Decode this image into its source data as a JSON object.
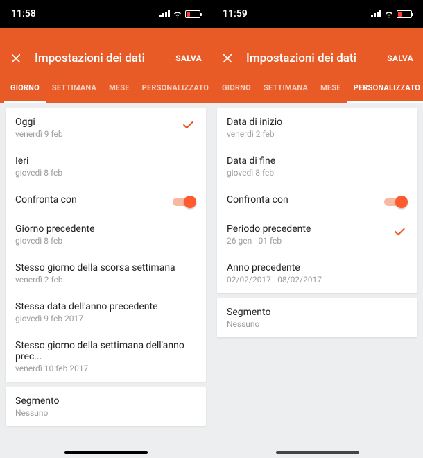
{
  "left": {
    "time": "11:58",
    "title": "Impostazioni dei dati",
    "save": "SALVA",
    "tabs": [
      {
        "label": "GIORNO",
        "active": true
      },
      {
        "label": "SETTIMANA",
        "active": false
      },
      {
        "label": "MESE",
        "active": false
      },
      {
        "label": "PERSONALIZZATO",
        "active": false
      }
    ],
    "card1": [
      {
        "title": "Oggi",
        "sub": "venerdì 9 feb",
        "checked": true
      },
      {
        "title": "Ieri",
        "sub": "giovedì 8 feb",
        "checked": false
      }
    ],
    "compare": {
      "title": "Confronta con",
      "on": true
    },
    "card1b": [
      {
        "title": "Giorno precedente",
        "sub": "giovedì 8 feb"
      },
      {
        "title": "Stesso giorno della scorsa settimana",
        "sub": "venerdì 2 feb"
      },
      {
        "title": "Stessa data dell'anno precedente",
        "sub": "giovedì 9 feb 2017"
      },
      {
        "title": "Stesso giorno della settimana dell'anno prec...",
        "sub": "venerdì 10 feb 2017"
      }
    ],
    "card2": {
      "title": "Segmento",
      "sub": "Nessuno"
    }
  },
  "right": {
    "time": "11:59",
    "title": "Impostazioni dei dati",
    "save": "SALVA",
    "tabs": [
      {
        "label": "GIORNO",
        "active": false
      },
      {
        "label": "SETTIMANA",
        "active": false
      },
      {
        "label": "MESE",
        "active": false
      },
      {
        "label": "PERSONALIZZATO",
        "active": true
      }
    ],
    "card1": [
      {
        "title": "Data di inizio",
        "sub": "venerdì 2 feb"
      },
      {
        "title": "Data di fine",
        "sub": "giovedì 8 feb"
      }
    ],
    "compare": {
      "title": "Confronta con",
      "on": true
    },
    "card1b": [
      {
        "title": "Periodo precedente",
        "sub": "26 gen - 01 feb",
        "checked": true
      },
      {
        "title": "Anno precedente",
        "sub": "02/02/2017 - 08/02/2017"
      }
    ],
    "card2": {
      "title": "Segmento",
      "sub": "Nessuno"
    }
  },
  "colors": {
    "accent": "#e85a26",
    "switch": "#ff5b2e"
  }
}
